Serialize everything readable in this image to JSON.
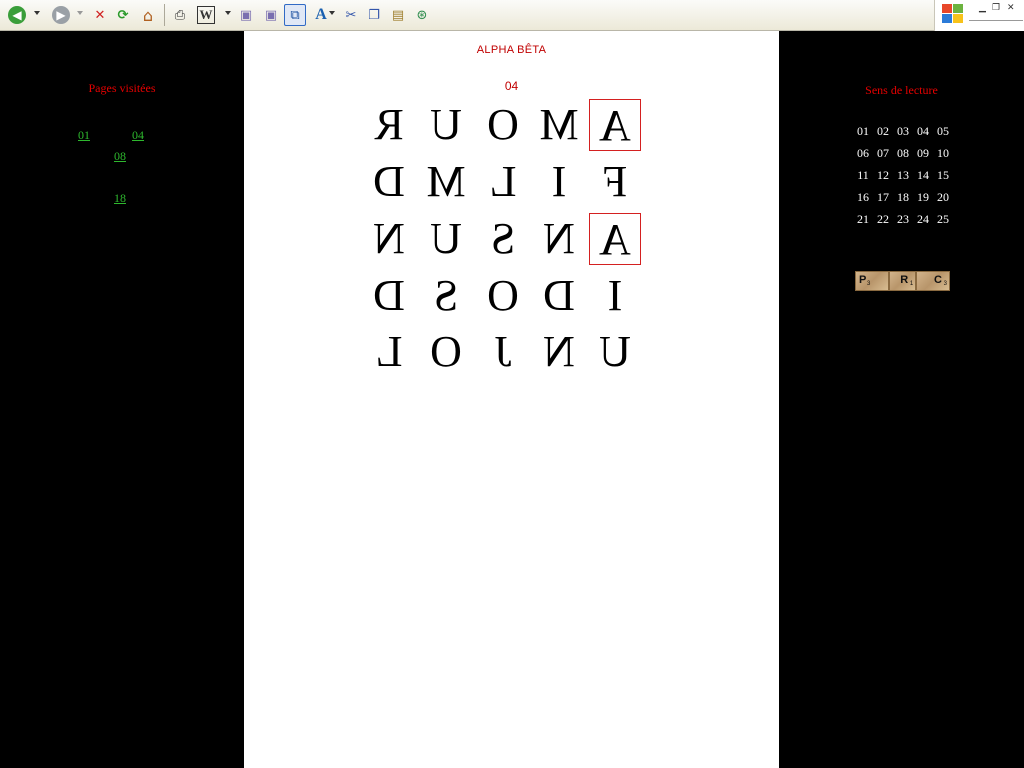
{
  "toolbar": {
    "buttons": [
      {
        "name": "back-icon",
        "glyph": "◀"
      },
      {
        "name": "forward-icon",
        "glyph": "▶"
      },
      {
        "name": "stop-icon",
        "glyph": "✕"
      },
      {
        "name": "refresh-icon",
        "glyph": "⟳"
      },
      {
        "name": "home-icon",
        "glyph": "⌂"
      },
      {
        "name": "print-icon",
        "glyph": "⎙"
      },
      {
        "name": "word-icon",
        "glyph": "W"
      },
      {
        "name": "package-icon",
        "glyph": "▣"
      },
      {
        "name": "package-delete-icon",
        "glyph": "▣"
      },
      {
        "name": "fullscreen-icon",
        "glyph": "⧉"
      },
      {
        "name": "font-icon",
        "glyph": "A"
      },
      {
        "name": "cut-icon",
        "glyph": "✂"
      },
      {
        "name": "copy-icon",
        "glyph": "❐"
      },
      {
        "name": "paste-icon",
        "glyph": "📋"
      },
      {
        "name": "sync-icon",
        "glyph": "⊛"
      }
    ]
  },
  "left": {
    "title": "Pages visitées",
    "links": [
      "01",
      "04",
      "08",
      "18"
    ]
  },
  "center": {
    "title": "ALPHA BÊTA",
    "page": "04",
    "grid": [
      [
        "R",
        "U",
        "O",
        "M",
        "A"
      ],
      [
        "D",
        "M",
        "L",
        "I",
        "F"
      ],
      [
        "N",
        "U",
        "S",
        "N",
        "A"
      ],
      [
        "D",
        "S",
        "O",
        "D",
        "I"
      ],
      [
        "L",
        "O",
        "J",
        "N",
        "U"
      ]
    ]
  },
  "right": {
    "title": "Sens de lecture",
    "numbers": [
      "01",
      "02",
      "03",
      "04",
      "05",
      "06",
      "07",
      "08",
      "09",
      "10",
      "11",
      "12",
      "13",
      "14",
      "15",
      "16",
      "17",
      "18",
      "19",
      "20",
      "21",
      "22",
      "23",
      "24",
      "25"
    ],
    "tiles": [
      {
        "letter": "P",
        "score": "3"
      },
      {
        "letter": "R",
        "score": "1"
      },
      {
        "letter": "C",
        "score": "3"
      }
    ]
  },
  "colors": {
    "accent_red": "#e60000",
    "link_green": "#2eb82e",
    "box_red": "#d42020"
  }
}
